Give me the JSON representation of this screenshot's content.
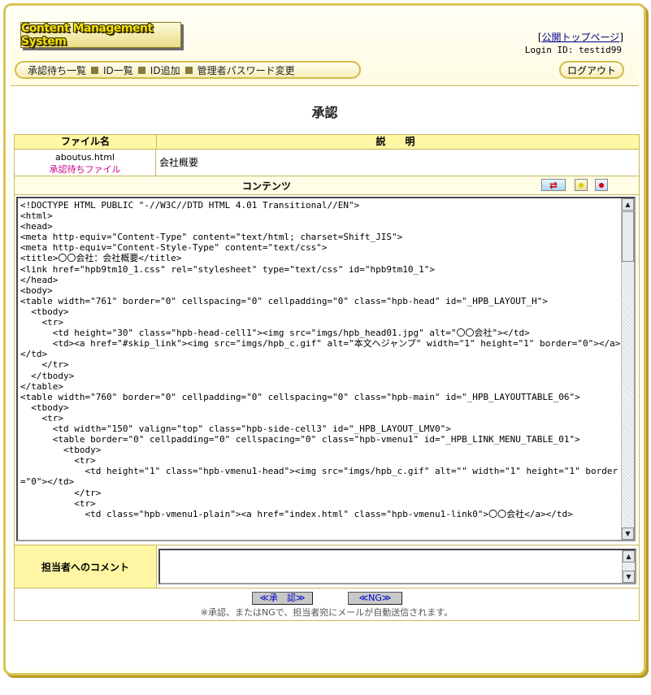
{
  "header": {
    "logo_text": "Content Management System",
    "top_link": "公開トップページ",
    "login_label": "Login ID: testid99",
    "logout_label": "ログアウト"
  },
  "nav": {
    "items": [
      {
        "label": "承認待ち一覧"
      },
      {
        "label": "ID一覧"
      },
      {
        "label": "ID追加"
      },
      {
        "label": "管理者パスワード変更"
      }
    ]
  },
  "page": {
    "title": "承認"
  },
  "table": {
    "col_file": "ファイル名",
    "col_desc": "説　明",
    "file_name": "aboutus.html",
    "file_status": "承認待ちファイル",
    "description": "会社概要",
    "content_label": "コンテンツ",
    "code": "<!DOCTYPE HTML PUBLIC \"-//W3C//DTD HTML 4.01 Transitional//EN\">\n<html>\n<head>\n<meta http-equiv=\"Content-Type\" content=\"text/html; charset=Shift_JIS\">\n<meta http-equiv=\"Content-Style-Type\" content=\"text/css\">\n<title>〇〇会社：会社概要</title>\n<link href=\"hpb9tm10_1.css\" rel=\"stylesheet\" type=\"text/css\" id=\"hpb9tm10_1\">\n</head>\n<body>\n<table width=\"761\" border=\"0\" cellspacing=\"0\" cellpadding=\"0\" class=\"hpb-head\" id=\"_HPB_LAYOUT_H\">\n  <tbody>\n    <tr>\n      <td height=\"30\" class=\"hpb-head-cell1\"><img src=\"imgs/hpb_head01.jpg\" alt=\"〇〇会社\"></td>\n      <td><a href=\"#skip_link\"><img src=\"imgs/hpb_c.gif\" alt=\"本文へジャンプ\" width=\"1\" height=\"1\" border=\"0\"></a></td>\n    </tr>\n  </tbody>\n</table>\n<table width=\"760\" border=\"0\" cellpadding=\"0\" cellspacing=\"0\" class=\"hpb-main\" id=\"_HPB_LAYOUTTABLE_06\">\n  <tbody>\n    <tr>\n      <td width=\"150\" valign=\"top\" class=\"hpb-side-cell3\" id=\"_HPB_LAYOUT_LMV0\">\n      <table border=\"0\" cellpadding=\"0\" cellspacing=\"0\" class=\"hpb-vmenu1\" id=\"_HPB_LINK_MENU_TABLE_01\">\n        <tbody>\n          <tr>\n            <td height=\"1\" class=\"hpb-vmenu1-head\"><img src=\"imgs/hpb_c.gif\" alt=\"\" width=\"1\" height=\"1\" border=\"0\"></td>\n          </tr>\n          <tr>\n            <td class=\"hpb-vmenu1-plain\"><a href=\"index.html\" class=\"hpb-vmenu1-link0\">〇〇会社</a></td>",
    "comment_label": "担当者へのコメント",
    "comment_value": ""
  },
  "actions": {
    "approve_label": "≪承　認≫",
    "ng_label": "≪NG≫",
    "note": "※承認、またはNGで、担当者宛にメールが自動送信されます。"
  }
}
